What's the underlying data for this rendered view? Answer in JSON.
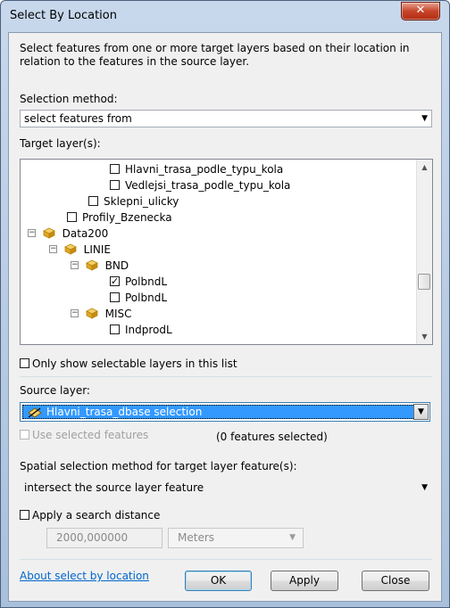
{
  "window": {
    "title": "Select By Location",
    "close_glyph": "✕"
  },
  "description": "Select features from one or more target layers based on their location in relation to the features in the source layer.",
  "selection_method": {
    "label": "Selection method:",
    "value": "select features from"
  },
  "target_layers": {
    "label": "Target layer(s):",
    "items": [
      {
        "label": "Hlavni_trasa_podle_typu_kola",
        "checked": false
      },
      {
        "label": "Vedlejsi_trasa_podle_typu_kola",
        "checked": false
      },
      {
        "label": "Sklepni_ulicky",
        "checked": false
      },
      {
        "label": "Profily_Bzenecka",
        "checked": false
      },
      {
        "label": "Data200",
        "group": true,
        "expanded": true
      },
      {
        "label": "LINIE",
        "group": true,
        "expanded": true
      },
      {
        "label": "BND",
        "group": true,
        "expanded": true
      },
      {
        "label": "PolbndL",
        "checked": true
      },
      {
        "label": "PolbndL",
        "checked": false
      },
      {
        "label": "MISC",
        "group": true,
        "expanded": true
      },
      {
        "label": "IndprodL",
        "checked": false
      }
    ]
  },
  "only_selectable": {
    "label": "Only show selectable layers in this list",
    "checked": false
  },
  "source_layer": {
    "label": "Source layer:",
    "value": "Hlavni_trasa_dbase selection"
  },
  "use_selected": {
    "label": "Use selected features",
    "count_text": "(0 features selected)"
  },
  "spatial_method": {
    "label": "Spatial selection method for target layer feature(s):",
    "value": "intersect the source layer feature"
  },
  "search_distance": {
    "label": "Apply a search distance",
    "value": "2000,000000",
    "units": "Meters"
  },
  "footer": {
    "help_link": "About select by location",
    "ok": "OK",
    "apply": "Apply",
    "close": "Close"
  },
  "icons": {
    "layer_group": "layer-group-icon",
    "expand": "minus-box-icon",
    "dropdown": "chevron-down-icon"
  },
  "colors": {
    "selection": "#3399ff",
    "link": "#0066cc",
    "close_button": "#c7452a"
  }
}
